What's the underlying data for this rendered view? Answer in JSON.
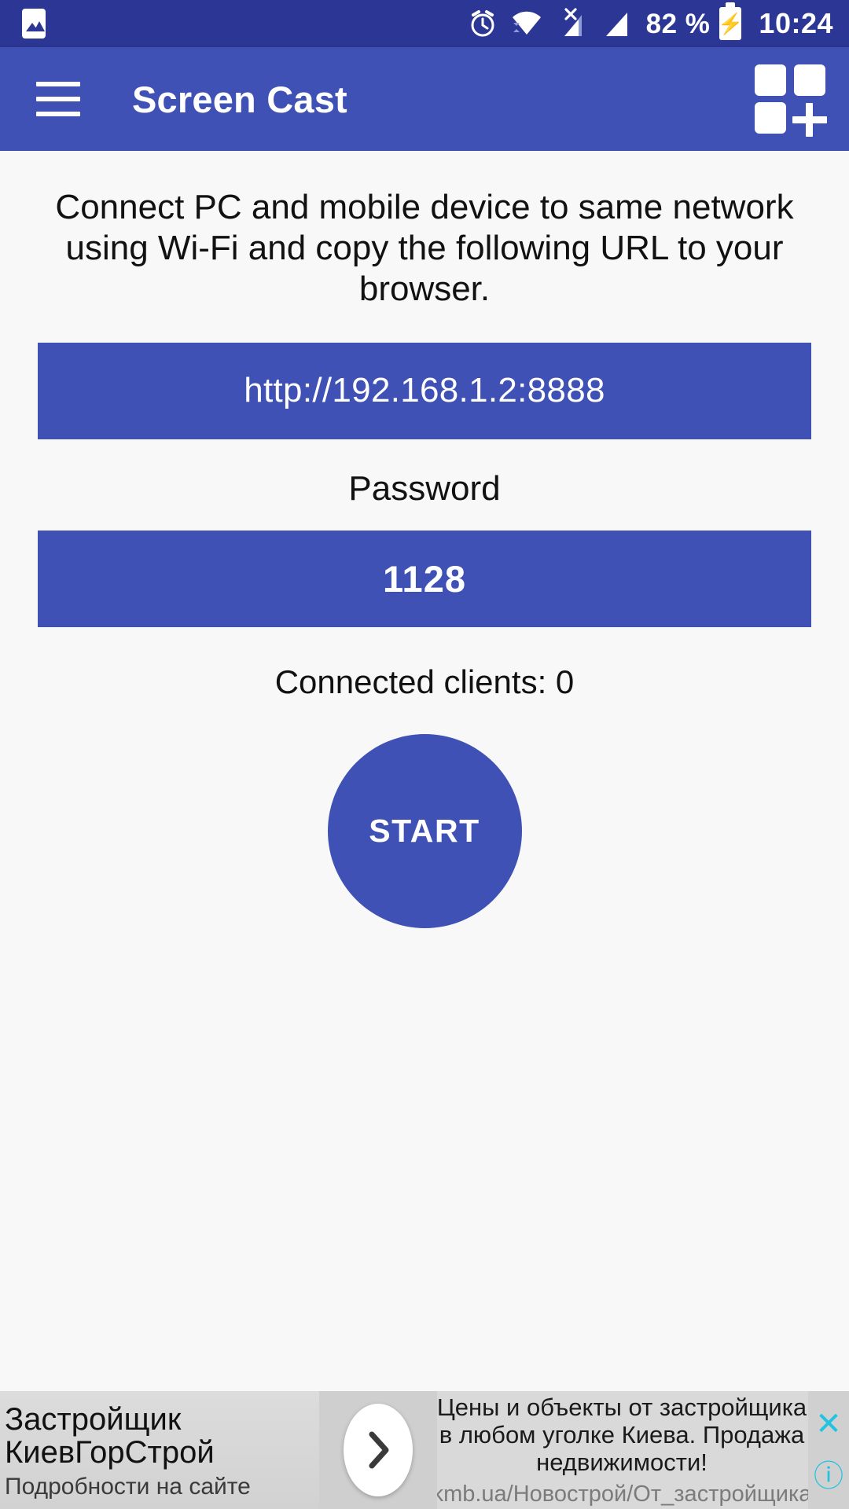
{
  "status_bar": {
    "icons": [
      "image-icon",
      "alarm-icon",
      "wifi-icon",
      "sim1-no-service-icon",
      "sim2-signal-icon"
    ],
    "battery_percent": "82 %",
    "battery_state": "charging",
    "clock": "10:24"
  },
  "app_bar": {
    "menu_label": "menu",
    "title": "Screen Cast",
    "action_label": "add-widget"
  },
  "main": {
    "instructions": "Connect PC and mobile device to same network using Wi-Fi and copy the following URL to your browser.",
    "url": "http://192.168.1.2:8888",
    "password_label": "Password",
    "password_value": "1128",
    "connected_clients": "Connected clients: 0",
    "start_label": "START"
  },
  "ad": {
    "headline_line1": "Застройщик",
    "headline_line2": "КиевГорСтрой",
    "subtitle": "Подробности на сайте",
    "body_line1": "Цены и объекты от застройщика",
    "body_line2": "в любом уголке Киева. Продажа",
    "body_line3": "недвижимости!",
    "url": "kmb.ua/Новострой/От_застройщика",
    "close_label": "✕",
    "info_label": "ⓘ",
    "arrow_label": "›"
  },
  "colors": {
    "status_bar": "#2c3795",
    "app_bar": "#3f51b5",
    "accent": "#3f51b5",
    "page_bg": "#f8f8f9",
    "ad_accent": "#21c3e0"
  }
}
